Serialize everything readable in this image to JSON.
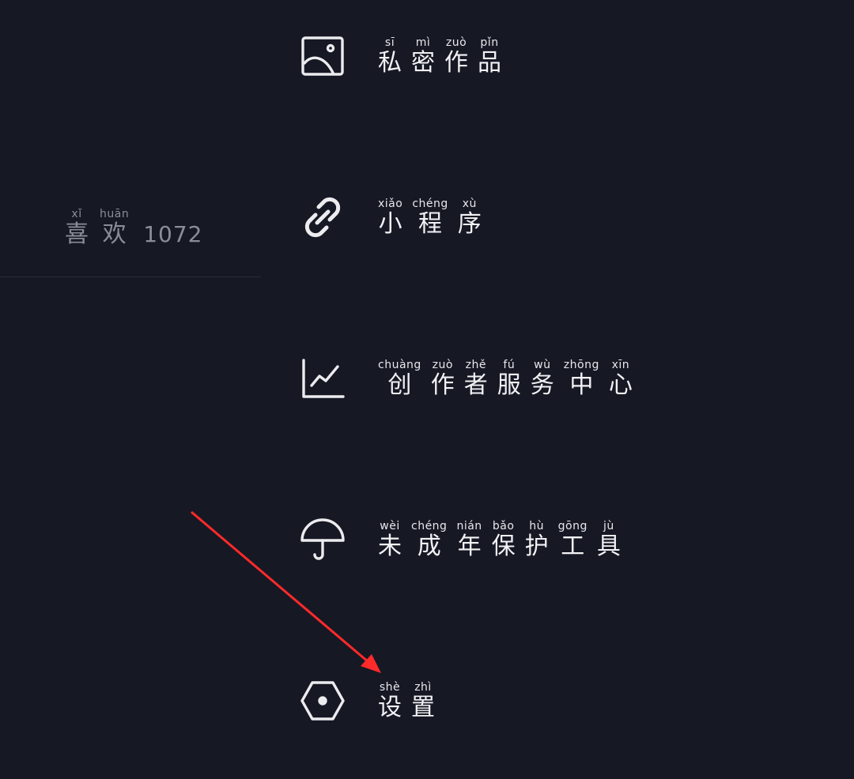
{
  "profile": {
    "likes": {
      "chars": [
        {
          "py": "xǐ",
          "hz": "喜"
        },
        {
          "py": "huān",
          "hz": "欢"
        }
      ],
      "count": "1072"
    }
  },
  "menu": {
    "items": [
      {
        "icon": "image-icon",
        "chars": [
          {
            "py": "sī",
            "hz": "私"
          },
          {
            "py": "mì",
            "hz": "密"
          },
          {
            "py": "zuò",
            "hz": "作"
          },
          {
            "py": "pǐn",
            "hz": "品"
          }
        ]
      },
      {
        "icon": "link-icon",
        "chars": [
          {
            "py": "xiǎo",
            "hz": "小"
          },
          {
            "py": "chéng",
            "hz": "程"
          },
          {
            "py": "xù",
            "hz": "序"
          }
        ]
      },
      {
        "icon": "trend-chart-icon",
        "chars": [
          {
            "py": "chuàng",
            "hz": "创"
          },
          {
            "py": "zuò",
            "hz": "作"
          },
          {
            "py": "zhě",
            "hz": "者"
          },
          {
            "py": "fú",
            "hz": "服"
          },
          {
            "py": "wù",
            "hz": "务"
          },
          {
            "py": "zhōng",
            "hz": "中"
          },
          {
            "py": "xīn",
            "hz": "心"
          }
        ]
      },
      {
        "icon": "umbrella-icon",
        "chars": [
          {
            "py": "wèi",
            "hz": "未"
          },
          {
            "py": "chéng",
            "hz": "成"
          },
          {
            "py": "nián",
            "hz": "年"
          },
          {
            "py": "bǎo",
            "hz": "保"
          },
          {
            "py": "hù",
            "hz": "护"
          },
          {
            "py": "gōng",
            "hz": "工"
          },
          {
            "py": "jù",
            "hz": "具"
          }
        ]
      },
      {
        "icon": "settings-hexagon-icon",
        "chars": [
          {
            "py": "shè",
            "hz": "设"
          },
          {
            "py": "zhì",
            "hz": "置"
          }
        ]
      }
    ]
  },
  "colors": {
    "background": "#161824",
    "text": "#f2f2f5",
    "muted": "#8b8d96",
    "arrow": "#ff2a2a"
  }
}
